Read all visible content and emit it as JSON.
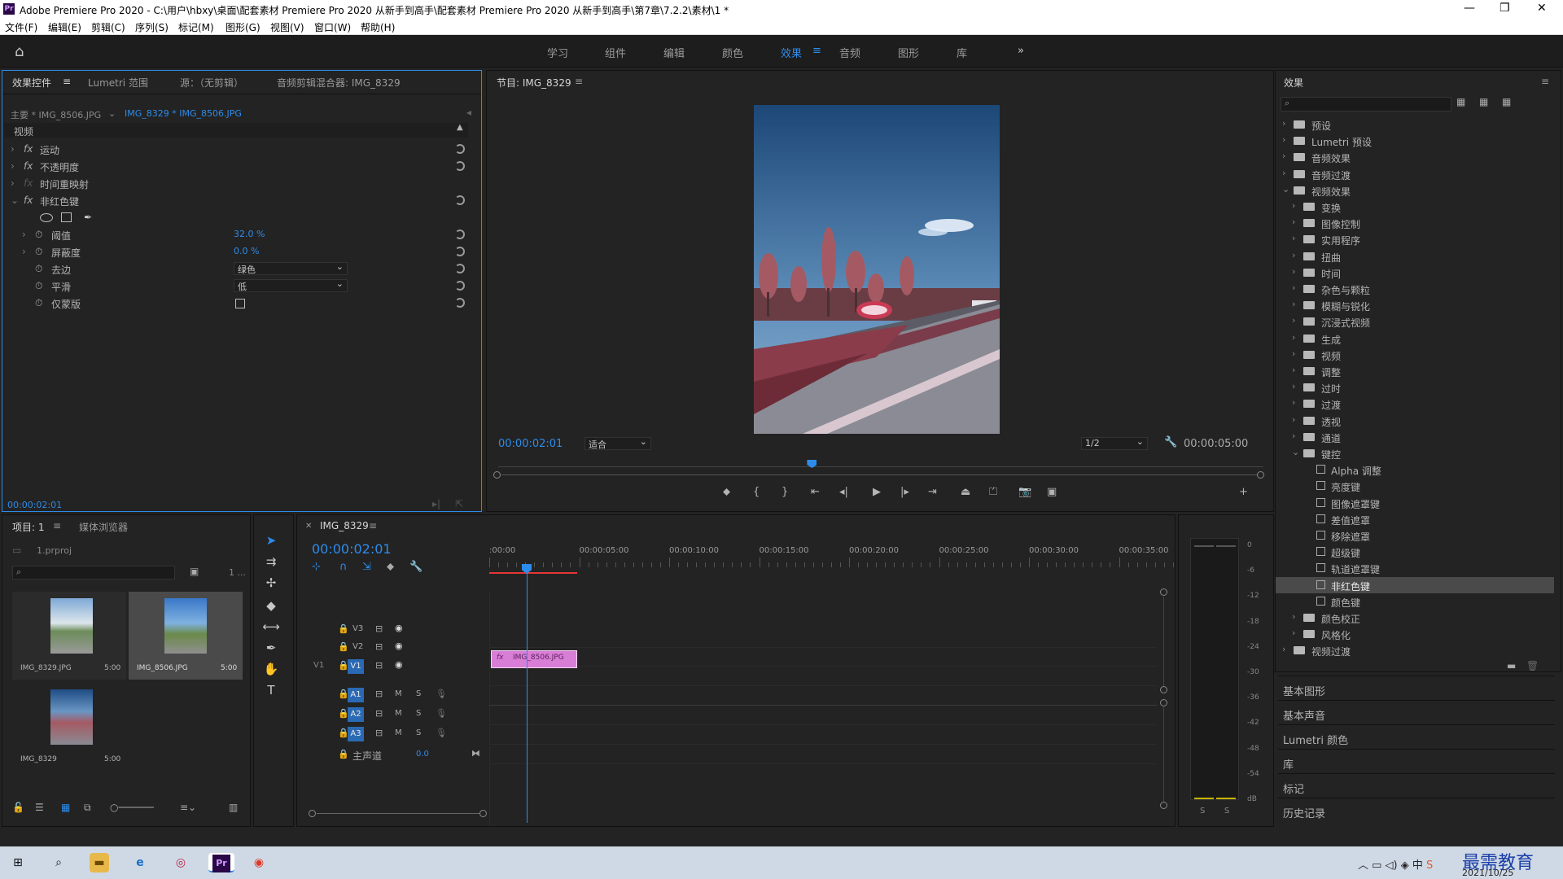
{
  "window": {
    "title": "Adobe Premiere Pro 2020 - C:\\用户\\hbxy\\桌面\\配套素材 Premiere Pro 2020 从新手到高手\\配套素材 Premiere Pro 2020 从新手到高手\\第7章\\7.2.2\\素材\\1 *",
    "app_icon": "Pr"
  },
  "menu": [
    "文件(F)",
    "编辑(E)",
    "剪辑(C)",
    "序列(S)",
    "标记(M)",
    "图形(G)",
    "视图(V)",
    "窗口(W)",
    "帮助(H)"
  ],
  "workspaces": [
    "学习",
    "组件",
    "编辑",
    "颜色",
    "效果",
    "音频",
    "图形",
    "库"
  ],
  "active_workspace": "效果",
  "effect_controls": {
    "tabs": [
      "效果控件",
      "Lumetri 范围",
      "源：（无剪辑）",
      "音频剪辑混合器: IMG_8329"
    ],
    "master": "主要 * IMG_8506.JPG",
    "clip": "IMG_8329 * IMG_8506.JPG",
    "section": "视频",
    "fx": [
      "运动",
      "不透明度",
      "时间重映射",
      "非红色键"
    ],
    "params": [
      {
        "name": "阈值",
        "value": "32.0 %"
      },
      {
        "name": "屏蔽度",
        "value": "0.0 %"
      },
      {
        "name": "去边",
        "value": "绿色"
      },
      {
        "name": "平滑",
        "value": "低"
      },
      {
        "name": "仅蒙版",
        "value": ""
      }
    ],
    "timecode": "00:00:02:01"
  },
  "program": {
    "title": "节目: IMG_8329",
    "timecode": "00:00:02:01",
    "fit": "适合",
    "resolution": "1/2",
    "duration": "00:00:05:00",
    "playhead_fraction": 0.41
  },
  "project": {
    "tabs": [
      "项目: 1",
      "媒体浏览器"
    ],
    "file": "1.prproj",
    "count": "1 ...",
    "items": [
      {
        "name": "IMG_8329.JPG",
        "dur": "5:00"
      },
      {
        "name": "IMG_8506.JPG",
        "dur": "5:00"
      },
      {
        "name": "IMG_8329",
        "dur": "5:00"
      }
    ]
  },
  "timeline": {
    "tab": "IMG_8329",
    "timecode": "00:00:02:01",
    "ruler": [
      ":00:00",
      "00:00:05:00",
      "00:00:10:00",
      "00:00:15:00",
      "00:00:20:00",
      "00:00:25:00",
      "00:00:30:00",
      "00:00:35:00"
    ],
    "tracks_video": [
      "V3",
      "V2",
      "V1"
    ],
    "tracks_audio": [
      "A1",
      "A2",
      "A3"
    ],
    "src_label": "V1",
    "mix_label": "主声道",
    "mix_value": "0.0",
    "clip": "IMG_8506.JPG",
    "m": "M",
    "s": "S"
  },
  "meter": {
    "scale": [
      "0",
      "-6",
      "-12",
      "-18",
      "-24",
      "-30",
      "-36",
      "-42",
      "-48",
      "-54",
      "dB"
    ],
    "solo": [
      "S",
      "S"
    ]
  },
  "effects": {
    "title": "效果",
    "tree": [
      {
        "label": "预设",
        "lvl": 0,
        "open": false
      },
      {
        "label": "Lumetri 预设",
        "lvl": 0,
        "open": false
      },
      {
        "label": "音频效果",
        "lvl": 0,
        "open": false
      },
      {
        "label": "音频过渡",
        "lvl": 0,
        "open": false
      },
      {
        "label": "视频效果",
        "lvl": 0,
        "open": true
      },
      {
        "label": "变换",
        "lvl": 1,
        "open": false
      },
      {
        "label": "图像控制",
        "lvl": 1,
        "open": false
      },
      {
        "label": "实用程序",
        "lvl": 1,
        "open": false
      },
      {
        "label": "扭曲",
        "lvl": 1,
        "open": false
      },
      {
        "label": "时间",
        "lvl": 1,
        "open": false
      },
      {
        "label": "杂色与颗粒",
        "lvl": 1,
        "open": false
      },
      {
        "label": "模糊与锐化",
        "lvl": 1,
        "open": false
      },
      {
        "label": "沉浸式视频",
        "lvl": 1,
        "open": false
      },
      {
        "label": "生成",
        "lvl": 1,
        "open": false
      },
      {
        "label": "视频",
        "lvl": 1,
        "open": false
      },
      {
        "label": "调整",
        "lvl": 1,
        "open": false
      },
      {
        "label": "过时",
        "lvl": 1,
        "open": false
      },
      {
        "label": "过渡",
        "lvl": 1,
        "open": false
      },
      {
        "label": "透视",
        "lvl": 1,
        "open": false
      },
      {
        "label": "通道",
        "lvl": 1,
        "open": false
      },
      {
        "label": "键控",
        "lvl": 1,
        "open": true
      },
      {
        "label": "Alpha 调整",
        "lvl": 2
      },
      {
        "label": "亮度键",
        "lvl": 2
      },
      {
        "label": "图像遮罩键",
        "lvl": 2
      },
      {
        "label": "差值遮罩",
        "lvl": 2
      },
      {
        "label": "移除遮罩",
        "lvl": 2
      },
      {
        "label": "超级键",
        "lvl": 2
      },
      {
        "label": "轨道遮罩键",
        "lvl": 2
      },
      {
        "label": "非红色键",
        "lvl": 2,
        "selected": true
      },
      {
        "label": "颜色键",
        "lvl": 2
      },
      {
        "label": "颜色校正",
        "lvl": 1,
        "open": false
      },
      {
        "label": "风格化",
        "lvl": 1,
        "open": false
      },
      {
        "label": "视频过渡",
        "lvl": 0,
        "open": false
      }
    ],
    "sections": [
      "基本图形",
      "基本声音",
      "Lumetri 颜色",
      "库",
      "标记",
      "历史记录"
    ]
  },
  "taskbar": {
    "date": "2021/10/25",
    "ime": "中",
    "brand": "最需教育"
  },
  "colors": {
    "accent": "#2d8ceb",
    "clip": "#d97ed6",
    "bg": "#232323"
  }
}
